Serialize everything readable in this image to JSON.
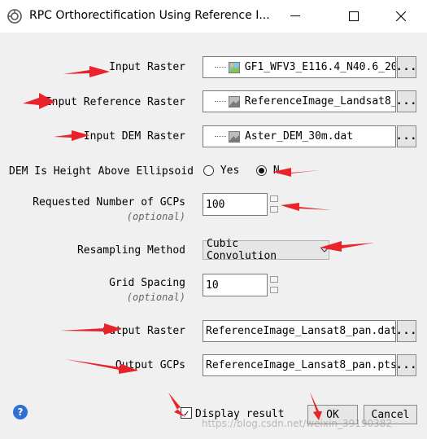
{
  "window": {
    "title": "RPC Orthorectification Using Reference I...",
    "minimize_glyph": "—",
    "maximize_glyph": "☐",
    "close_glyph": "✕"
  },
  "form": {
    "input_raster": {
      "label": "Input Raster",
      "value": "GF1_WFV3_E116.4_N40.6_20",
      "button": "..."
    },
    "input_reference_raster": {
      "label": "Input Reference Raster",
      "value": "ReferenceImage_Landsat8_",
      "button": "..."
    },
    "input_dem_raster": {
      "label": "Input DEM Raster",
      "value": "Aster_DEM_30m.dat",
      "button": "..."
    },
    "dem_height_above_ellipsoid": {
      "label": "DEM Is Height Above Ellipsoid",
      "yes": "Yes",
      "no": "N",
      "selected": "no"
    },
    "requested_gcps": {
      "label": "Requested Number of GCPs",
      "optional": "(optional)",
      "value": "100"
    },
    "resampling_method": {
      "label": "Resampling Method",
      "value": "Cubic Convolution",
      "chevron": "⌄"
    },
    "grid_spacing": {
      "label": "Grid Spacing",
      "optional": "(optional)",
      "value": "10"
    },
    "output_raster": {
      "label": "Output Raster",
      "value": "ReferenceImage_Lansat8_pan.dat",
      "button": "..."
    },
    "output_gcps": {
      "label": "Output GCPs",
      "value": "ReferenceImage_Lansat8_pan.pts",
      "button": "..."
    }
  },
  "footer": {
    "help_glyph": "?",
    "display_result": {
      "label": "Display result",
      "checked": true,
      "check_glyph": "✓"
    },
    "ok_label": "OK",
    "cancel_label": "Cancel",
    "watermark": "https://blog.csdn.net/weixin_39190382"
  },
  "colors": {
    "annotation_arrow": "#e8232a",
    "help_icon": "#2f6fd6",
    "titlebar": "#ffffff",
    "dialog": "#f0f0f0"
  }
}
